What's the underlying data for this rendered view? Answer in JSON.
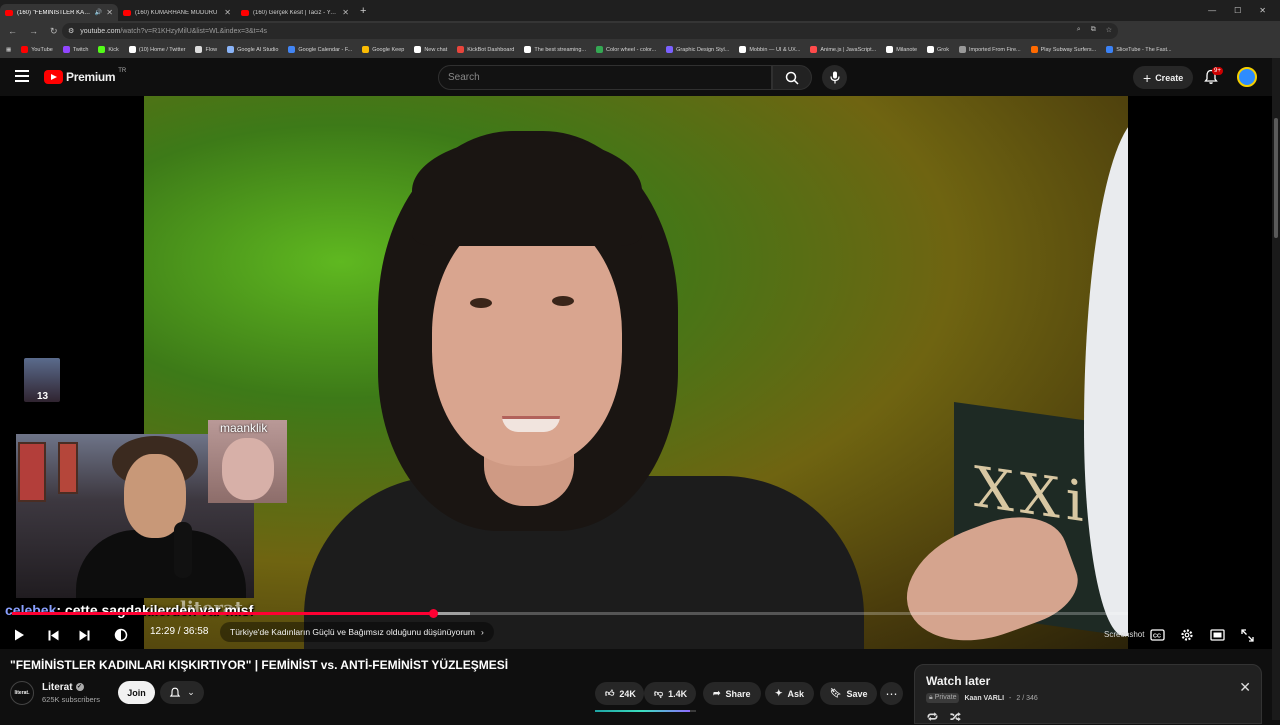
{
  "browser": {
    "tabs": [
      {
        "title": "(160) \"FEMİNİSTLER KADINLARI KIŞKIRTIYOR\"",
        "active": true
      },
      {
        "title": "(160) KUMARHANE MÜDÜRÜ",
        "active": false
      },
      {
        "title": "(160) Gerçek Kesit | Taciz - YouTube",
        "active": false
      }
    ],
    "url_host": "youtube.com",
    "url_path": "/watch?v=R1KHzyMilU&list=WL&index=3&t=4s",
    "bookmarks": [
      {
        "label": "YouTube",
        "color": "#ff0000"
      },
      {
        "label": "Twitch",
        "color": "#9146ff"
      },
      {
        "label": "Kick",
        "color": "#53fc18"
      },
      {
        "label": "(10) Home / Twitter",
        "color": "#ffffff"
      },
      {
        "label": "Flow",
        "color": "#dddddd"
      },
      {
        "label": "Google AI Studio",
        "color": "#8ab4f8"
      },
      {
        "label": "Google Calendar - F...",
        "color": "#4285f4"
      },
      {
        "label": "Google Keep",
        "color": "#fbbc04"
      },
      {
        "label": "New chat",
        "color": "#ffffff"
      },
      {
        "label": "KickBot Dashboard",
        "color": "#e8453c"
      },
      {
        "label": "The best streaming...",
        "color": "#ffffff"
      },
      {
        "label": "Color wheel - color...",
        "color": "#34a853"
      },
      {
        "label": "Graphic Design Styl...",
        "color": "#7b61ff"
      },
      {
        "label": "Mobbin — UI & UX...",
        "color": "#ffffff"
      },
      {
        "label": "Anime.js | JavaScript...",
        "color": "#ff4b4b"
      },
      {
        "label": "Milanote",
        "color": "#ffffff"
      },
      {
        "label": "Grok",
        "color": "#ffffff"
      },
      {
        "label": "Imported From Fire...",
        "color": "#999999"
      },
      {
        "label": "Play Subway Surfers...",
        "color": "#ff6a00"
      },
      {
        "label": "SliceTube - The Fast...",
        "color": "#3b82f6"
      }
    ]
  },
  "header": {
    "logo_word": "Premium",
    "logo_region": "TR",
    "search_placeholder": "Search",
    "create_label": "Create",
    "notifications_badge": "9+"
  },
  "player": {
    "chat_user": "celebek",
    "chat_message": ": cette sagdakilerden var mısf",
    "viewer_cam_name": "maanklik",
    "small_cam_badge": "13",
    "watermark": "literat",
    "board_text": "XXi X",
    "current_time": "12:29",
    "duration": "36:58",
    "time_separator": " / ",
    "chapter_title": "Türkiye'de Kadınların Güçlü ve Bağımsız olduğunu düşünüyorum",
    "screenshot_label": "Screenshot",
    "settings_badge": "HD",
    "progress_fraction": 0.377,
    "buffer_fraction": 0.41
  },
  "video_info": {
    "title": "\"FEMİNİSTLER KADINLARI KIŞKIRTIYOR\" | FEMİNİST vs. ANTİ-FEMİNİST YÜZLEŞMESİ",
    "channel_name": "Literat",
    "channel_avatar_text": "literat.",
    "subscribers": "625K subscribers",
    "join_label": "Join",
    "likes": "24K",
    "dislikes": "1.4K",
    "share_label": "Share",
    "ask_label": "Ask",
    "save_label": "Save",
    "like_ratio": 0.94
  },
  "watch_later": {
    "title": "Watch later",
    "privacy": "Private",
    "owner": "Kaan VARLI",
    "position": "2 / 346",
    "separator": " - "
  }
}
